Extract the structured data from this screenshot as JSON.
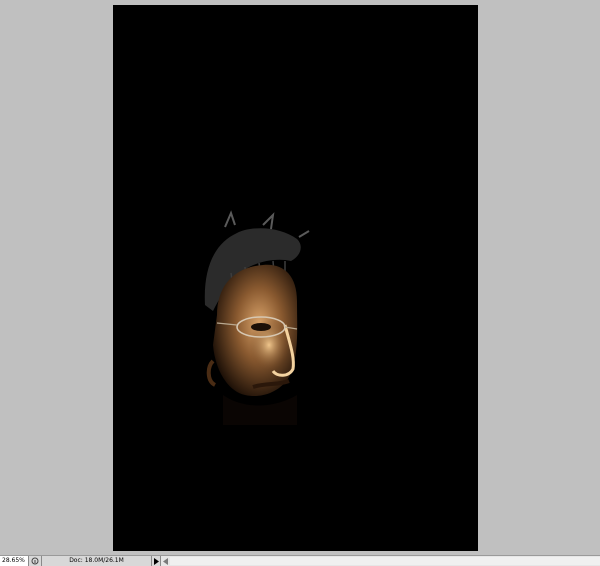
{
  "statusbar": {
    "zoom": "28.65%",
    "doc_info": "Doc: 18.0M/26.1M"
  },
  "icons": {
    "status_icon": "info-circle-icon",
    "menu_arrow": "triangle-right-icon",
    "scroll_left": "triangle-left-icon"
  },
  "colors": {
    "workspace": "#c0c0c0",
    "document_bg": "#000000"
  }
}
